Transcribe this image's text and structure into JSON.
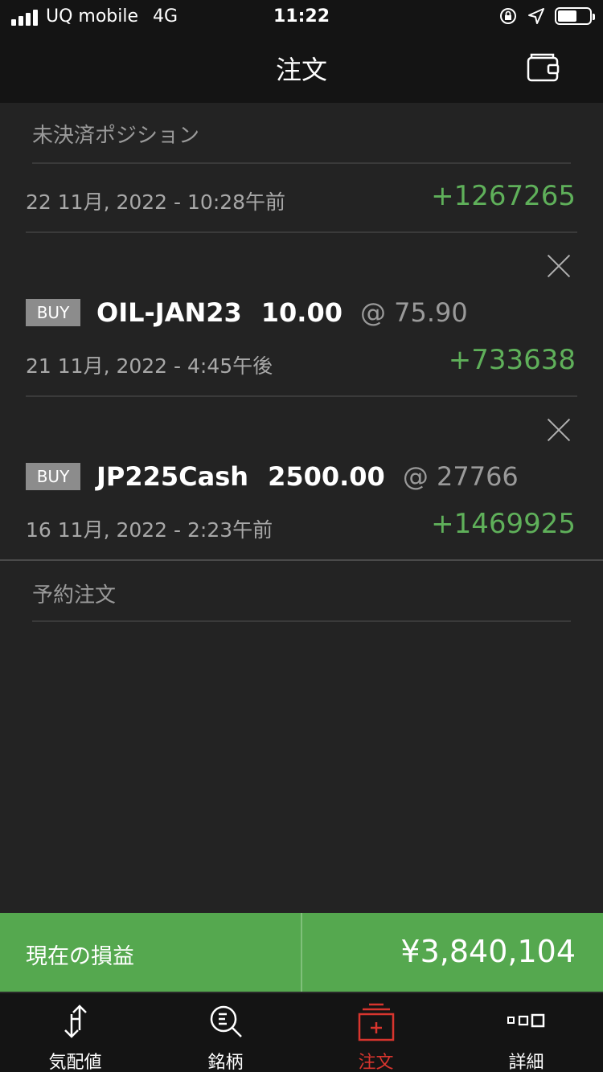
{
  "status_bar": {
    "carrier": "UQ mobile",
    "network": "4G",
    "time": "11:22"
  },
  "header": {
    "title": "注文",
    "right_icon": "wallet-icon"
  },
  "open_positions": {
    "section_title": "未決済ポジション",
    "summary": {
      "date": "22 11月, 2022 - 10:28午前",
      "pl": "+1267265"
    },
    "items": [
      {
        "side": "BUY",
        "symbol": "OIL-JAN23",
        "quantity": "10.00",
        "price": "@ 75.90",
        "date": "21 11月, 2022 - 4:45午後",
        "pl": "+733638"
      },
      {
        "side": "BUY",
        "symbol": "JP225Cash",
        "quantity": "2500.00",
        "price": "@ 27766",
        "date": "16 11月, 2022 - 2:23午前",
        "pl": "+1469925"
      }
    ]
  },
  "pending_orders": {
    "section_title": "予約注文"
  },
  "pl_bar": {
    "label": "現在の損益",
    "value": "¥3,840,104"
  },
  "tabs": [
    {
      "label": "気配値",
      "icon": "quotes-arrows-icon",
      "active": false
    },
    {
      "label": "銘柄",
      "icon": "search-list-icon",
      "active": false
    },
    {
      "label": "注文",
      "icon": "order-plus-icon",
      "active": true
    },
    {
      "label": "詳細",
      "icon": "more-dots-icon",
      "active": false
    }
  ],
  "colors": {
    "profit": "#5fb05a",
    "pl_bar": "#55a84f",
    "active_tab": "#d8352e",
    "background": "#232323",
    "header": "#141414"
  }
}
